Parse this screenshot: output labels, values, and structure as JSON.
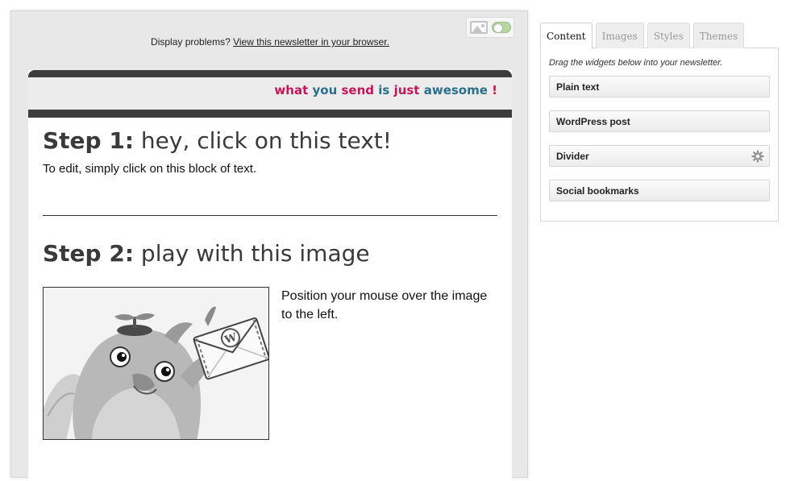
{
  "editor": {
    "display_problems_text": "Display problems? ",
    "view_in_browser_link": "View this newsletter in your browser.",
    "image_toggle": {
      "icon": "image-icon",
      "state": "on"
    },
    "header": {
      "tagline_words": [
        "what",
        "you",
        "send",
        "is",
        "just",
        "awesome",
        "!"
      ],
      "accent_color": "#c2185b",
      "secondary_color": "#2a6f8c"
    },
    "step1": {
      "label": "Step 1:",
      "title": " hey, click on this text!",
      "text": "To edit, simply click on this block of text."
    },
    "step2": {
      "label": "Step 2:",
      "title": " play with this image",
      "image_desc_text": "Position your mouse over the image to the left."
    }
  },
  "panel": {
    "tabs": [
      {
        "label": "Content",
        "active": true
      },
      {
        "label": "Images",
        "active": false
      },
      {
        "label": "Styles",
        "active": false
      },
      {
        "label": "Themes",
        "active": false
      }
    ],
    "hint": "Drag the widgets below into your newsletter.",
    "widgets": [
      {
        "label": "Plain text",
        "icon": ""
      },
      {
        "label": "WordPress post",
        "icon": ""
      },
      {
        "label": "Divider",
        "icon": "gear-icon"
      },
      {
        "label": "Social bookmarks",
        "icon": ""
      }
    ]
  },
  "colors": {
    "bar_dark": "#3d3d3d",
    "editor_bg": "#e8e8e8",
    "panel_border": "#d7d7d7"
  }
}
